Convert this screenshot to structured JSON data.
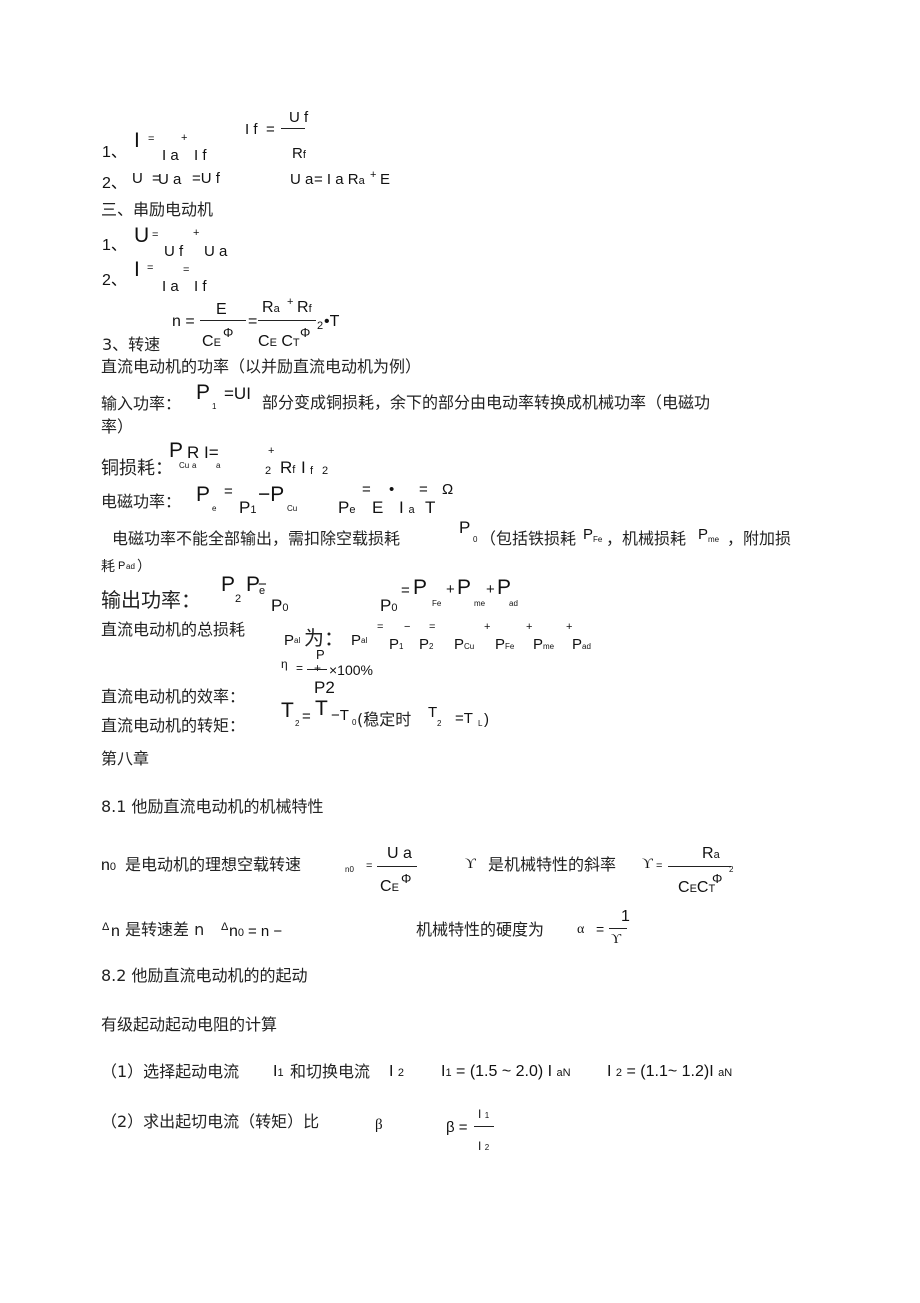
{
  "shunt": {
    "f1_num": "1、",
    "f1_I": "I",
    "f1_eq": "=",
    "f1_Ia": "I a",
    "f1_plus": "+",
    "f1_If": "I f",
    "f1b_If": "I f",
    "f1b_eq": "=",
    "f1b_Uf": "U f",
    "f1b_Rf": "R",
    "f1b_Rf_sub": "f",
    "f2_num": "2、",
    "f2_U": "U",
    "f2_eq1": "=",
    "f2_Ua": "U a",
    "f2_eq2": "=U f",
    "f2b_Ua": "U a",
    "f2b_rest": "= I a R",
    "f2b_sub": "a",
    "f2b_plus": "+",
    "f2b_E": "E"
  },
  "series": {
    "heading": "三、串励电动机",
    "f1_num": "1、",
    "f1_U": "U",
    "f1_eq": "=",
    "f1_Uf": "U f",
    "f1_plus": "+",
    "f1_Ua": "U a",
    "f2_num": "2、",
    "f2_I": "I",
    "f2_eq": "=",
    "f2_Ia": "I a",
    "f2_eq2": "=",
    "f2_If": "I f",
    "f3_num": "3、转速",
    "n": "n =",
    "E": "E",
    "eq2": "=",
    "Ra": "R",
    "Ra_sub": "a",
    "plus": "+",
    "Rf": "R",
    "Rf_sub": "f",
    "two": "2",
    "dotT": "•T",
    "CE1": "C",
    "CE1_sub": "E",
    "Phi1": "Φ",
    "CE2": "C",
    "CE2_sub": "E",
    "CT": "C",
    "CT_sub": "T",
    "Phi2": "Φ"
  },
  "power": {
    "heading": "直流电动机的功率（以并励直流电动机为例）",
    "input_label": "输入功率：",
    "input_P": "P",
    "input_sub": "1",
    "input_eq": "=UI",
    "input_text": "部分变成铜损耗，余下的部分由电动率转换成机械功率（电磁功",
    "input_text2": "率）",
    "cu_label": "铜损耗：",
    "cu_P": "P",
    "cu_R": "R",
    "cu_I": "I=",
    "cu_sub_cu": "Cu",
    "cu_sub_a1": "a",
    "cu_sub_a2": "a",
    "cu_plus": "+",
    "cu_two": "2",
    "cu_Rf": "R",
    "cu_Rf_sub": "f",
    "cu_If": "I",
    "cu_If_sub": "f",
    "cu_two2": "2",
    "em_label": "电磁功率：",
    "em_P": "P",
    "em_sub": "e",
    "em_eq": "=",
    "em_P1": "P",
    "em_P1_sub": "1",
    "em_minus": "−P",
    "em_cu": "Cu",
    "em_Pe": "P",
    "em_Pe_sub": "e",
    "em_eq2": "=",
    "em_E": "E",
    "em_dot": "•",
    "em_I": "I",
    "em_I_sub": "a",
    "em_eq3": "=",
    "em_T": "T",
    "em_omega": "Ω",
    "noload_text": "电磁功率不能全部输出，需扣除空载损耗",
    "noload_P": "P",
    "noload_sub": "0",
    "noload_text2": "（包括铁损耗",
    "fe_P": "P",
    "fe_sub": "Fe",
    "noload_text3": "，机械损耗",
    "me_P": "P",
    "me_sub": "me",
    "noload_text4": "，附加损",
    "noload_text5": "耗",
    "ad_P": "P",
    "ad_sub": "ad",
    "noload_close": "）",
    "out_label": "输出功率：",
    "out_P": "P",
    "out_sub": "2",
    "out_Pe": "P",
    "out_Pe_sub": "e",
    "out_minus": "−",
    "out_P0": "P",
    "out_P0_sub": "0",
    "p0_P": "P",
    "p0_sub": "0",
    "p0_eq": "=",
    "p0_Pfe": "P",
    "p0_fe": "Fe",
    "p0_plus1": "+",
    "p0_Pme": "P",
    "p0_me": "me",
    "p0_plus2": "+",
    "p0_Pad": "P",
    "p0_ad": "ad",
    "loss_label": "直流电动机的总损耗",
    "loss_Pal": "P",
    "loss_al": "al",
    "loss_wei": "为：",
    "loss_Pal2": "P",
    "loss_al2": "al",
    "loss_ops": [
      "=",
      "−",
      "=",
      "+",
      "+",
      "+"
    ],
    "loss_terms": [
      {
        "P": "P",
        "sub": "1"
      },
      {
        "P": "P",
        "sub": "2"
      },
      {
        "P": "P",
        "sub": "Cu"
      },
      {
        "P": "P",
        "sub": "Fe"
      },
      {
        "P": "P",
        "sub": "me"
      },
      {
        "P": "P",
        "sub": "ad"
      }
    ],
    "eff_eta": "η",
    "eff_eq": "=",
    "eff_num": "P",
    "eff_frac_bar": "+",
    "eff_times": "×100%",
    "eff_den": "P",
    "eff_den_sub": "2",
    "eff_label": "直流电动机的效率：",
    "torque_label": "直流电动机的转矩：",
    "tq_T2": "T",
    "tq_T2_sub": "2",
    "tq_eq": "=",
    "tq_T": "T",
    "tq_minus": "−T",
    "tq_T0_sub": "0",
    "tq_paren": "(稳定时",
    "tq_T2b": "T",
    "tq_T2b_sub": "2",
    "tq_eq2": "=T",
    "tq_L": "L",
    "tq_close": ")"
  },
  "chapter8": {
    "title": "第八章",
    "s81": "8.1   他励直流电动机的机械特性",
    "n0_label_n": "n",
    "n0_label_sub": "0",
    "n0_text": "是电动机的理想空载转速",
    "n0f_n": "n",
    "n0f_sub": "0",
    "n0f_eq": "=",
    "n0f_Ua": "U a",
    "n0f_CE": "C",
    "n0f_CE_sub": "E",
    "n0f_phi": "Φ",
    "gamma": "ϒ",
    "gamma_text": "是机械特性的斜率",
    "gf_gamma": "ϒ",
    "gf_eq": "=",
    "gf_Ra": "R",
    "gf_Ra_sub": "a",
    "gf_CE": "C",
    "gf_E": "E",
    "gf_CT": "C",
    "gf_T": "T",
    "gf_phi": "Φ",
    "gf_two": "2",
    "dn_delta": "Δ",
    "dn_n": "n",
    "dn_text": "是转速差 n",
    "dn_delta2": "Δ",
    "dn_n0": "n",
    "dn_n0_sub": "0",
    "dn_rest": "= n −",
    "hard_text": "机械特性的硬度为",
    "alpha": "α",
    "alpha_eq": "=",
    "alpha_num": "1",
    "alpha_den": "ϒ",
    "s82": "8.2   他励直流电动机的的起动",
    "steps_title": "有级起动起动电阻的计算",
    "step1": "（1）选择起动电流",
    "step1_I1": "I",
    "step1_I1_sub": "1",
    "step1_and": "和切换电流",
    "step1_I2": "I",
    "step1_I2_sub": "2",
    "eq1_I": "I",
    "eq1_sub": "1",
    "eq1_rest": "= (1.5 ~ 2.0) I",
    "eq1_aN": "aN",
    "eq2_I": "I",
    "eq2_sub": "2",
    "eq2_rest": "= (1.1~ 1.2)I",
    "eq2_aN": "aN",
    "step2": "（2）求出起切电流（转矩）比",
    "beta": "β",
    "beta_eq": "β =",
    "beta_num": "I",
    "beta_num_sub": "1",
    "beta_den": "I",
    "beta_den_sub": "2"
  }
}
